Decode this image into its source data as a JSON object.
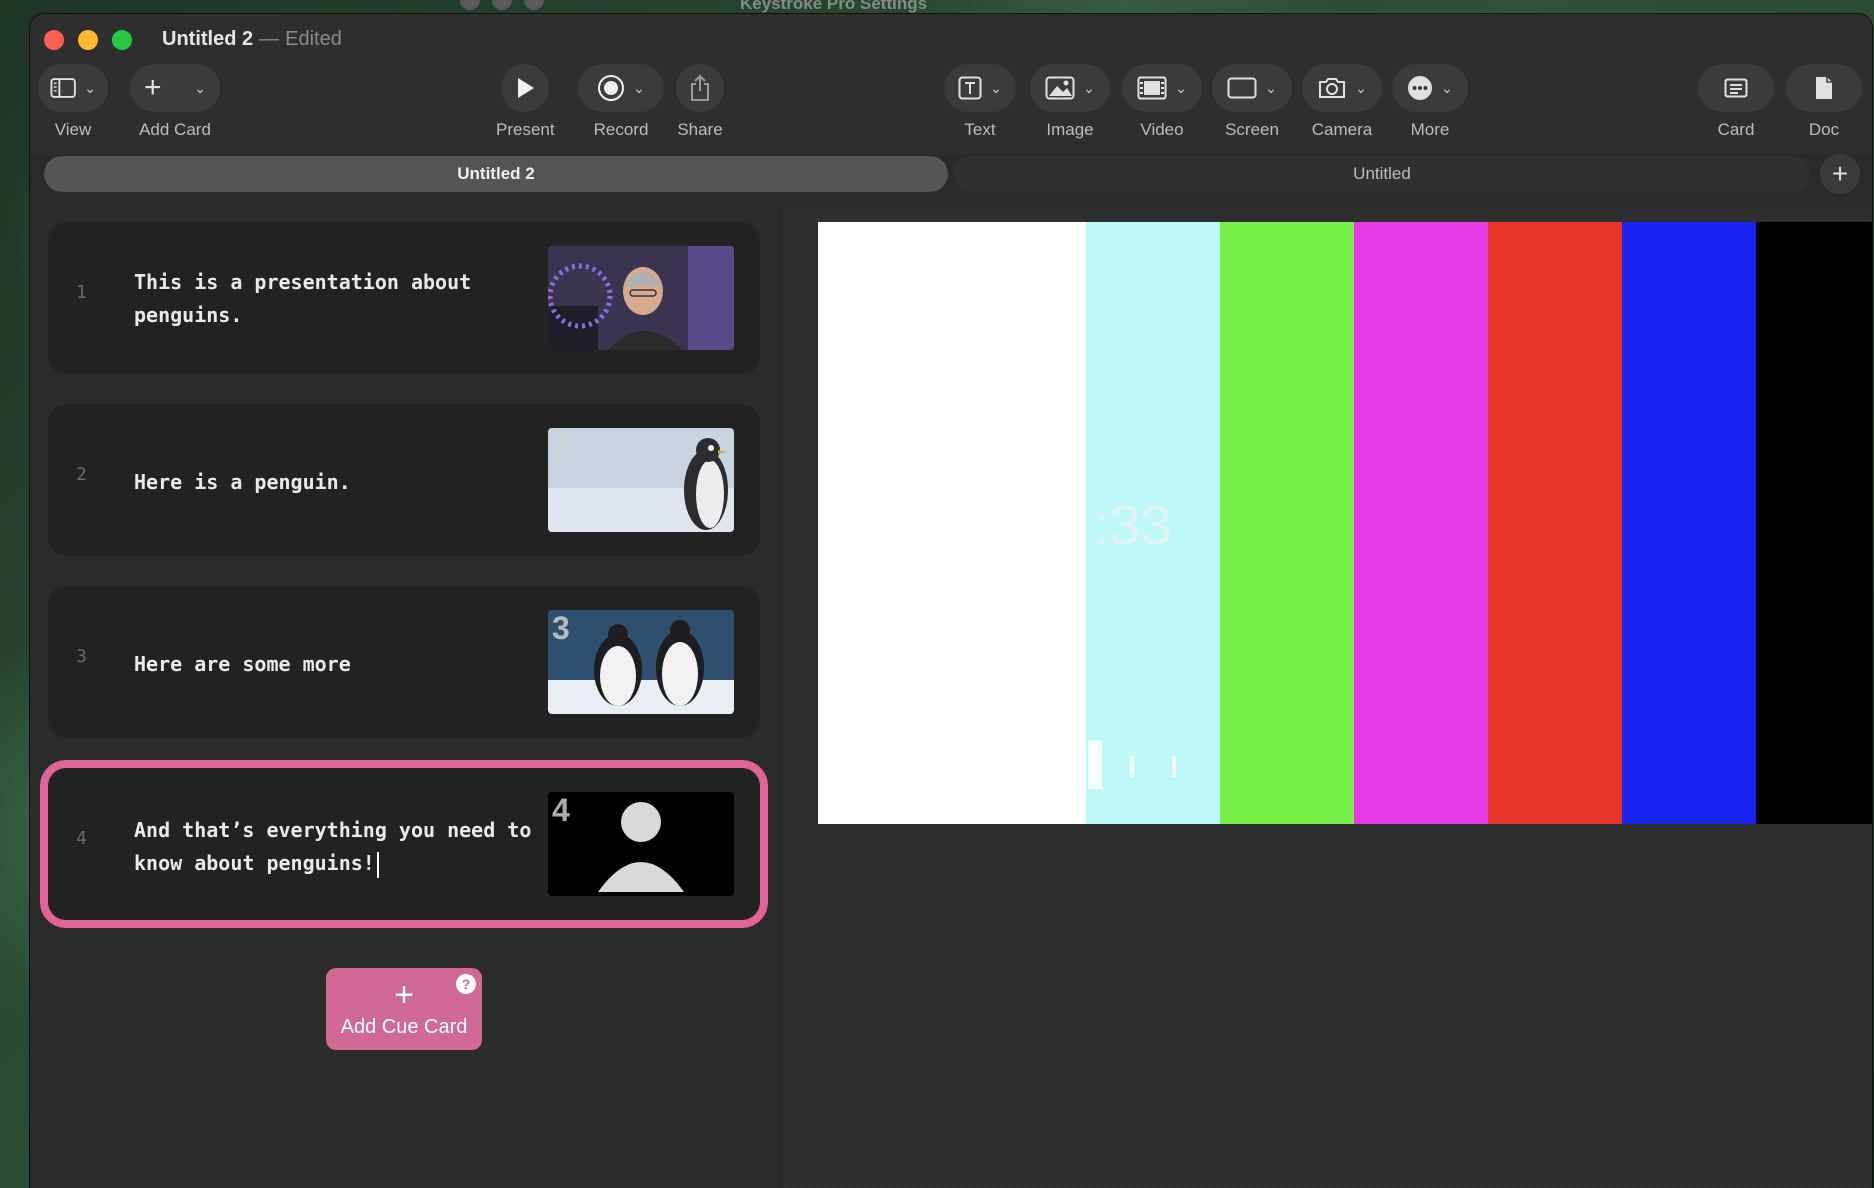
{
  "background_window": {
    "title": "Keystroke Pro Settings"
  },
  "window": {
    "title": "Untitled 2",
    "separator": "—",
    "status": "Edited"
  },
  "toolbar": {
    "view": {
      "label": "View",
      "icon": "sidebar-icon"
    },
    "add_card": {
      "label": "Add Card",
      "icon": "plus-icon"
    },
    "present": {
      "label": "Present",
      "icon": "play-icon"
    },
    "record": {
      "label": "Record",
      "icon": "record-icon"
    },
    "share": {
      "label": "Share",
      "icon": "share-icon"
    },
    "text": {
      "label": "Text",
      "icon": "text-box-icon"
    },
    "image": {
      "label": "Image",
      "icon": "image-icon"
    },
    "video": {
      "label": "Video",
      "icon": "film-icon"
    },
    "screen": {
      "label": "Screen",
      "icon": "screen-icon"
    },
    "camera": {
      "label": "Camera",
      "icon": "camera-icon"
    },
    "more": {
      "label": "More",
      "icon": "ellipsis-icon"
    },
    "card": {
      "label": "Card",
      "icon": "card-icon"
    },
    "doc": {
      "label": "Doc",
      "icon": "document-icon"
    }
  },
  "tabs": [
    {
      "label": "Untitled 2",
      "active": true
    },
    {
      "label": "Untitled",
      "active": false
    }
  ],
  "cards": [
    {
      "number": "1",
      "text": "This is a presentation about penguins.",
      "thumb": "presenter-webcam"
    },
    {
      "number": "2",
      "text": "Here is a penguin.",
      "thumb_number": "2",
      "thumb": "single-penguin"
    },
    {
      "number": "3",
      "text": "Here are some more",
      "thumb_number": "3",
      "thumb": "two-penguins"
    },
    {
      "number": "4",
      "text": "And that’s everything you need to know about penguins!",
      "thumb_number": "4",
      "thumb": "person-placeholder",
      "selected": true
    }
  ],
  "add_cue_card": {
    "label": "Add Cue Card",
    "help": "?"
  },
  "preview": {
    "overlay_time": ":33",
    "overlay_marks": "▌ı ı",
    "color_bars": [
      "#ffffff",
      "#bff8f8",
      "#77f04a",
      "#e83be8",
      "#e8352a",
      "#1a22f0",
      "#000000"
    ]
  },
  "colors": {
    "accent": "#e2649a",
    "add_cue_bg": "#d06a95"
  }
}
